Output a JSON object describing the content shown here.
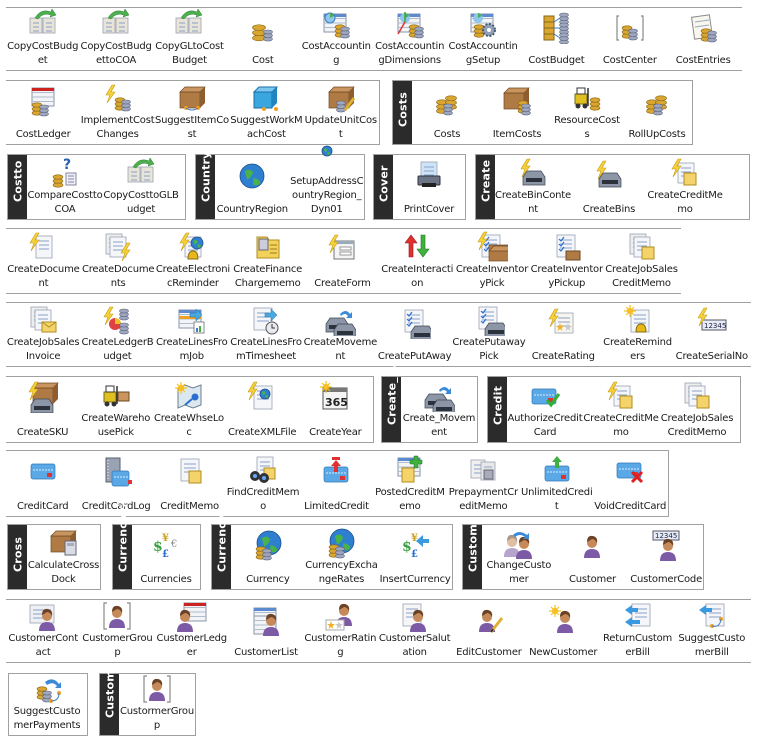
{
  "groups": [
    {
      "id": "g1",
      "header": null,
      "items": [
        {
          "label": "CopyCostBudget",
          "icon": "copy-budget-icon"
        },
        {
          "label": "CopyCostBudgettoCOA",
          "icon": "copy-budget-coa-icon"
        },
        {
          "label": "CopyGLtoCostBudget",
          "icon": "copy-gl-budget-icon"
        },
        {
          "label": "Cost",
          "icon": "coins-database-icon"
        },
        {
          "label": "CostAccounting",
          "icon": "chart-coins-icon"
        },
        {
          "label": "CostAccountingDimensions",
          "icon": "chart-axes-coins-icon"
        },
        {
          "label": "CostAccountingSetup",
          "icon": "chart-gear-icon"
        },
        {
          "label": "CostBudget",
          "icon": "coins-network-icon"
        },
        {
          "label": "CostCenter",
          "icon": "bracket-coins-icon"
        },
        {
          "label": "CostEntries",
          "icon": "notebook-coins-icon"
        }
      ]
    },
    {
      "id": "g2",
      "header": null,
      "items": [
        {
          "label": "CostLedger",
          "icon": "ledger-coins-icon"
        },
        {
          "label": "ImplementCostChanges",
          "icon": "lightning-coins-icon"
        },
        {
          "label": "SuggestItemCost",
          "icon": "box-workflow-icon"
        },
        {
          "label": "SuggestWorkMachCost",
          "icon": "cube-workflow-icon"
        },
        {
          "label": "UpdateUnitCost",
          "icon": "box-pencil-icon"
        }
      ]
    },
    {
      "id": "g3",
      "header": "Costs",
      "items": [
        {
          "label": "Costs",
          "icon": "coins-stack-icon"
        },
        {
          "label": "ItemCosts",
          "icon": "box-coins-icon"
        },
        {
          "label": "ResourceCosts",
          "icon": "forklift-coins-icon"
        },
        {
          "label": "RollUpCosts",
          "icon": "coins-stack-icon"
        }
      ]
    },
    {
      "id": "g4",
      "header": "Costto",
      "items": [
        {
          "label": "CompareCosttoCOA",
          "icon": "question-coins-icon"
        },
        {
          "label": "CopyCosttoGLBudget",
          "icon": "copy-budget-icon"
        }
      ]
    },
    {
      "id": "g5",
      "header": "Country",
      "items": [
        {
          "label": "CountryRegion",
          "icon": "globe-icon"
        },
        {
          "label": "SetupAddressCountryRegion_Dyn01",
          "icon": "globe-small-icon"
        }
      ]
    },
    {
      "id": "g6",
      "header": "Cover",
      "items": [
        {
          "label": "PrintCover",
          "icon": "printer-icon"
        }
      ]
    },
    {
      "id": "g7",
      "header": "Create",
      "items": [
        {
          "label": "CreateBinContent",
          "icon": "lightning-bin-icon"
        },
        {
          "label": "CreateBins",
          "icon": "lightning-bin-icon"
        },
        {
          "label": "CreateCreditMemo",
          "icon": "lightning-memo-icon"
        }
      ]
    },
    {
      "id": "g8",
      "header": null,
      "items": [
        {
          "label": "CreateDocument",
          "icon": "lightning-document-icon"
        },
        {
          "label": "CreateDocuments",
          "icon": "documents-lightning-icon"
        },
        {
          "label": "CreateElectronicReminder",
          "icon": "lightning-globe-bell-icon"
        },
        {
          "label": "CreateFinanceChargememo",
          "icon": "folder-calculator-icon"
        },
        {
          "label": "CreateForm",
          "icon": "lightning-form-icon"
        },
        {
          "label": "CreateInteraction",
          "icon": "arrows-up-down-icon"
        },
        {
          "label": "CreateInventoryPick",
          "icon": "lightning-checklist-box-icon"
        },
        {
          "label": "CreateInventoryPickup",
          "icon": "checklist-box-icon"
        },
        {
          "label": "CreateJobSalesCreditMemo",
          "icon": "documents-memo-icon"
        }
      ]
    },
    {
      "id": "g9",
      "header": null,
      "items": [
        {
          "label": "CreateJobSalesInvoice",
          "icon": "documents-envelope-icon"
        },
        {
          "label": "CreateLedgerBudget",
          "icon": "lightning-database-icon"
        },
        {
          "label": "CreateLinesFromJob",
          "icon": "grid-arrow-icon"
        },
        {
          "label": "CreateLinesFromTimesheet",
          "icon": "sheet-clock-arrow-icon"
        },
        {
          "label": "CreateMovement",
          "icon": "bins-move-icon"
        },
        {
          "label": "CreatePutAway",
          "icon": "checklist-bin-icon"
        },
        {
          "label": "CreatePutawayPick",
          "icon": "checklist-bin-icon"
        },
        {
          "label": "CreateRating",
          "icon": "lightning-stars-icon"
        },
        {
          "label": "CreateReminders",
          "icon": "star-bell-document-icon"
        },
        {
          "label": "CreateSerialNo",
          "icon": "lightning-numbers-icon"
        }
      ]
    },
    {
      "id": "g10",
      "header": null,
      "items": [
        {
          "label": "CreateSKU",
          "icon": "lightning-box-bin-icon"
        },
        {
          "label": "CreateWarehousePick",
          "icon": "forklift-icon"
        },
        {
          "label": "CreateWhseLoc",
          "icon": "star-map-key-icon"
        },
        {
          "label": "CreateXMLFile",
          "icon": "lightning-xml-globe-icon"
        },
        {
          "label": "CreateYear",
          "icon": "calendar-365-icon"
        }
      ]
    },
    {
      "id": "g11",
      "header": "Create_...",
      "items": [
        {
          "label": "Create_Movement",
          "icon": "bins-move-icon"
        }
      ]
    },
    {
      "id": "g12",
      "header": "Credit",
      "items": [
        {
          "label": "AuthorizeCreditCard",
          "icon": "credit-card-check-icon"
        },
        {
          "label": "CreateCreditMemo",
          "icon": "lightning-memo-icon"
        },
        {
          "label": "CreateJobSalesCreditMemo",
          "icon": "documents-memo-icon"
        }
      ]
    },
    {
      "id": "g13",
      "header": null,
      "items": [
        {
          "label": "CreditCard",
          "icon": "credit-card-icon"
        },
        {
          "label": "CreditCardLog",
          "icon": "notebook-card-icon"
        },
        {
          "label": "CreditMemo",
          "icon": "memo-document-icon"
        },
        {
          "label": "FindCreditMemo",
          "icon": "binoculars-memo-icon"
        },
        {
          "label": "LimitedCredit",
          "icon": "credit-card-limit-icon"
        },
        {
          "label": "PostedCreditMemo",
          "icon": "memo-plus-icon"
        },
        {
          "label": "PrepaymentCreditMemo",
          "icon": "documents-gray-icon"
        },
        {
          "label": "UnlimitedCredit",
          "icon": "credit-card-up-icon"
        },
        {
          "label": "VoidCreditCard",
          "icon": "credit-card-x-icon"
        }
      ]
    },
    {
      "id": "g14",
      "header": "Cross",
      "items": [
        {
          "label": "CalculateCrossDock",
          "icon": "box-calculator-icon"
        }
      ]
    },
    {
      "id": "g15",
      "header": "Currencies",
      "items": [
        {
          "label": "Currencies",
          "icon": "currency-symbols-icon"
        }
      ]
    },
    {
      "id": "g16",
      "header": "Currency",
      "items": [
        {
          "label": "Currency",
          "icon": "globe-coins-icon"
        },
        {
          "label": "CurrencyExchangeRates",
          "icon": "globe-coins-icon"
        },
        {
          "label": "InsertCurrency",
          "icon": "currency-arrow-icon"
        }
      ]
    },
    {
      "id": "g17",
      "header": "Customer",
      "items": [
        {
          "label": "ChangeCustomer",
          "icon": "people-arrow-icon"
        },
        {
          "label": "Customer",
          "icon": "person-icon"
        },
        {
          "label": "CustomerCode",
          "icon": "person-numbers-icon"
        }
      ]
    },
    {
      "id": "g18",
      "header": null,
      "items": [
        {
          "label": "CustomerContact",
          "icon": "card-person-icon"
        },
        {
          "label": "CustomerGroup",
          "icon": "bracket-person-icon"
        },
        {
          "label": "CustomerLedger",
          "icon": "ledger-person-icon"
        },
        {
          "label": "CustomerList",
          "icon": "list-person-icon"
        },
        {
          "label": "CustomerRating",
          "icon": "stars-person-icon"
        },
        {
          "label": "CustomerSalutation",
          "icon": "document-person-icon"
        },
        {
          "label": "EditCustomer",
          "icon": "person-pencil-icon"
        },
        {
          "label": "NewCustomer",
          "icon": "star-person-icon"
        },
        {
          "label": "ReturnCustomerBill",
          "icon": "arrows-document-icon"
        },
        {
          "label": "SuggestCustomerBill",
          "icon": "arrow-workflow-document-icon"
        }
      ]
    },
    {
      "id": "g19",
      "header": null,
      "items": [
        {
          "label": "SuggestCustomerPayments",
          "icon": "coins-workflow-icon"
        }
      ]
    },
    {
      "id": "g20",
      "header": "Customer",
      "items": [
        {
          "label": "CustormerGroup",
          "icon": "bracket-person-icon"
        }
      ]
    }
  ]
}
